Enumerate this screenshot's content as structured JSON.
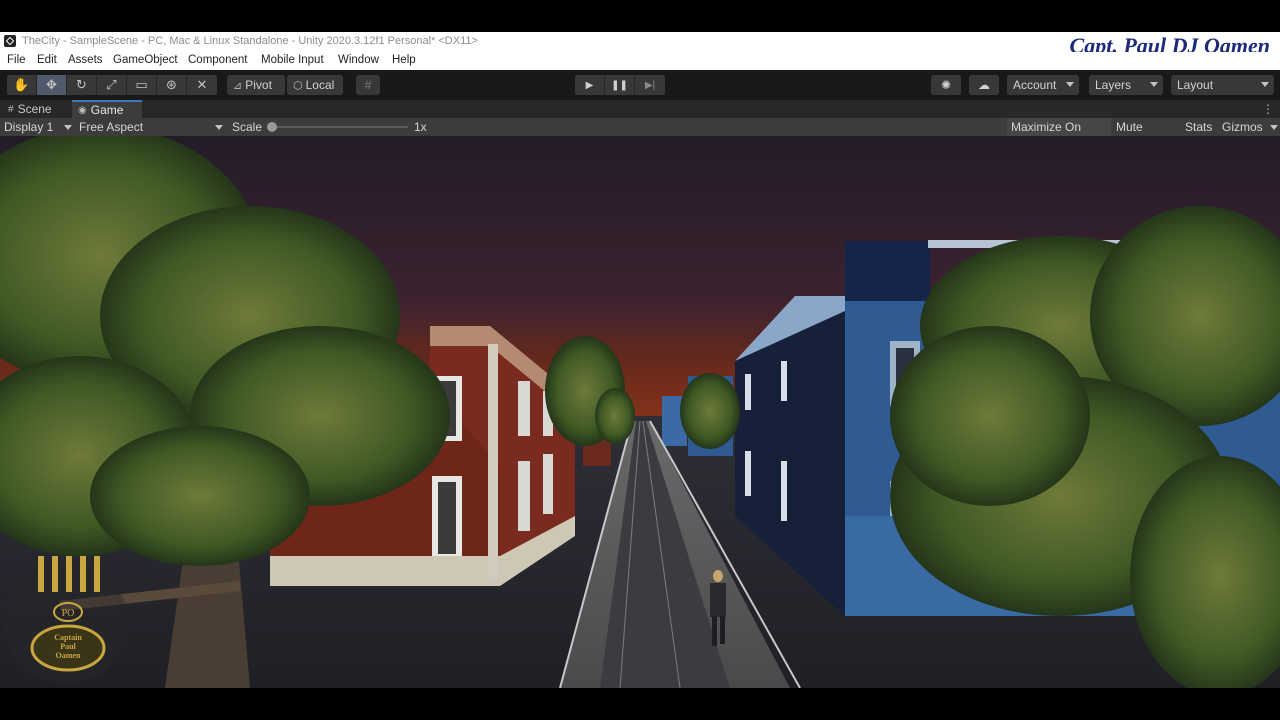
{
  "window": {
    "title": "TheCity - SampleScene - PC, Mac & Linux Standalone - Unity 2020.3.12f1 Personal* <DX11>",
    "watermark": "Capt. Paul DJ Oamen"
  },
  "menu": [
    "File",
    "Edit",
    "Assets",
    "GameObject",
    "Component",
    "Mobile Input",
    "Window",
    "Help"
  ],
  "toolbar": {
    "tools": [
      "hand-tool-icon",
      "move-tool-icon",
      "rotate-tool-icon",
      "scale-tool-icon",
      "rect-tool-icon",
      "transform-tool-icon",
      "custom-tool-icon"
    ],
    "pivot_label": "Pivot",
    "local_label": "Local",
    "account_label": "Account",
    "layers_label": "Layers",
    "layout_label": "Layout"
  },
  "tabs": [
    {
      "label": "Scene",
      "icon": "grid-icon",
      "active": false
    },
    {
      "label": "Game",
      "icon": "gamepad-icon",
      "active": true
    }
  ],
  "game_bar": {
    "display": "Display 1",
    "aspect": "Free Aspect",
    "scale_label": "Scale",
    "scale_value": "1x",
    "maximize": "Maximize On Play",
    "mute": "Mute Audio",
    "stats": "Stats",
    "gizmos": "Gizmos"
  },
  "logo": {
    "initials": "PO",
    "line1": "Captain",
    "line2": "Paul",
    "line3": "Oamen"
  },
  "colors": {
    "accent_tab": "#3a79bb",
    "sky_top": "#2a1e2c",
    "sky_horizon": "#7a2a18",
    "brick": "#7a2a1e",
    "blue_building": "#2f5a92",
    "road": "#3c3c40"
  }
}
